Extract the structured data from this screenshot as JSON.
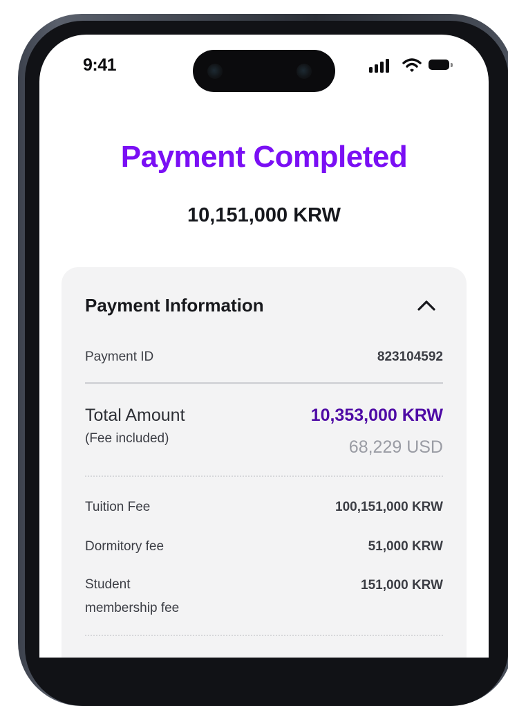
{
  "status_bar": {
    "time": "9:41"
  },
  "header": {
    "title": "Payment Completed",
    "amount": "10,151,000 KRW"
  },
  "payment_info": {
    "title": "Payment Information",
    "payment_id_label": "Payment ID",
    "payment_id_value": "823104592",
    "total_label": "Total Amount",
    "fee_note": "(Fee included)",
    "total_krw": "10,353,000 KRW",
    "total_usd": "68,229 USD",
    "items": [
      {
        "label": "Tuition Fee",
        "value": "100,151,000 KRW"
      },
      {
        "label": "Dormitory fee",
        "value": "51,000 KRW"
      },
      {
        "label_line1": "Student",
        "label_line2": "membership fee",
        "value": "151,000 KRW"
      }
    ]
  },
  "colors": {
    "title": "#7a0ff4",
    "total_krw": "#4e0aa5",
    "card_bg": "#f3f3f4"
  },
  "icons": [
    "signal-icon",
    "wifi-icon",
    "battery-icon",
    "chevron-up-icon"
  ]
}
